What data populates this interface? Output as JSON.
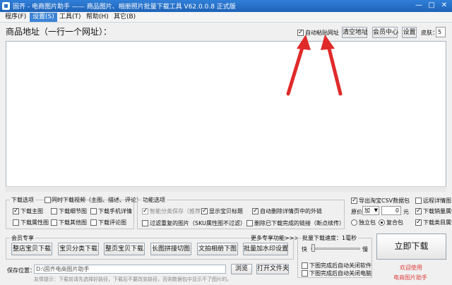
{
  "window": {
    "title": "固齐 - 电商图片助手 —— 商品图片、相册照片批量下载工具 V62.0.0.8 正式版",
    "controls": [
      "—",
      "□",
      "✕"
    ]
  },
  "menu": [
    "程序(F)",
    "设置(S)",
    "工具(T)",
    "帮助(H)",
    "其它(B)"
  ],
  "address": {
    "label": "商品地址（一行一个网址）：",
    "auto_paste": "自动粘贴网址",
    "clear": "清空地址",
    "member_center": "会员中心",
    "settings": "设置",
    "skin_label": "皮肤：",
    "skin_value": "5"
  },
  "download_options": {
    "title": "下载选项",
    "video": "同时下载视频（主图、描述、评论）",
    "main": "下载主图",
    "detail": "下载细节图",
    "mobile_detail": "下载手机详情",
    "sku": "下载属性图",
    "other": "下载其他图",
    "review": "下载评论图"
  },
  "function_options": {
    "title": "功能选项",
    "smart_save": "智能分类保存（推荐）",
    "show_title": "显示宝贝标题",
    "auto_delete": "自动删除详情页中的外链",
    "filter_dup": "过滤重复的图片（SKU属性图不过滤）",
    "delete_done": "删除已下载完成的链接（断点续传）"
  },
  "csv": {
    "export_csv": "导出淘宝CSV数据包",
    "remote_detail": "远程详情图",
    "price_label": "原价",
    "price_op": "加",
    "price_value": "0",
    "price_unit": "元",
    "sales_attr": "下载销量属性",
    "standalone": "独立包",
    "combined": "复合包",
    "sold_attr": "下载类目属性"
  },
  "member": {
    "title": "会员专享",
    "more": "更多专享功能>>>",
    "buttons": [
      "整店宝贝下载",
      "宝贝分类下载",
      "整页宝贝下载",
      "长图拼接切图",
      "文拍相册下图",
      "批量加水印设置"
    ]
  },
  "speed": {
    "title": "批量下载速度：1毫秒",
    "fast": "快",
    "slow": "慢",
    "open_after": "下图完成后自动关闭软件",
    "shutdown_after": "下图完成后自动关闭电脑"
  },
  "save": {
    "label": "保存位置：",
    "path": "D:\\固齐电商图片助手",
    "browse": "浏览",
    "open_folder": "打开文件夹",
    "hint": "友情提示：下载前请先选择好路径，下载后不要改变路径，否则数据包中显示不了图片的。"
  },
  "start": {
    "label": "立即下载",
    "welcome1": "欢迎使用",
    "welcome2": "电商图片助手"
  },
  "colors": {
    "titlebar": "#2a70c8",
    "arrow": "#e02a2a",
    "welcome": "#e04040"
  }
}
